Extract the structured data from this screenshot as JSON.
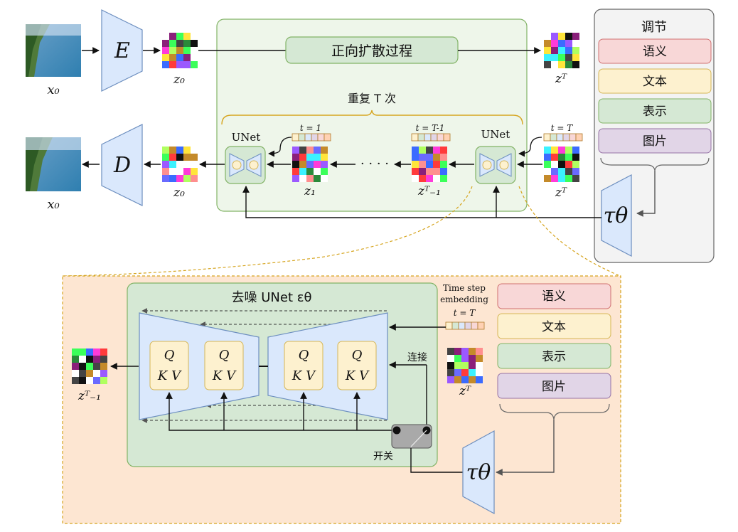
{
  "top": {
    "x0_in": "x₀",
    "x0_out": "x₀",
    "encoder": "E",
    "decoder": "D",
    "z0_in": "z₀",
    "z0_out": "z₀",
    "zT_top": "zᵀ",
    "forward_process": "正向扩散过程",
    "repeat": "重复 T 次",
    "unet_left": "UNet",
    "unet_right": "UNet",
    "z1": "z₁",
    "zT1": "zᵀ₋₁",
    "zT_mid": "zᵀ",
    "t1": "t = 1",
    "tT1": "t = T-1",
    "tT": "t = T",
    "dots": "· · · ·",
    "tau": "τθ"
  },
  "conditioning": {
    "title": "调节",
    "items": [
      {
        "label": "语义",
        "color": "#f8d7d7",
        "border": "#d07070"
      },
      {
        "label": "文本",
        "color": "#fdf1cf",
        "border": "#d6b656"
      },
      {
        "label": "表示",
        "color": "#d5e8d4",
        "border": "#82b366"
      },
      {
        "label": "图片",
        "color": "#e1d5e7",
        "border": "#9673a6"
      }
    ]
  },
  "detail": {
    "title": "去噪 UNet εθ",
    "time_step": "Time step",
    "embedding": "embedding",
    "tT": "t = T",
    "concat": "连接",
    "switch": "开关",
    "z_out": "zᵀ₋₁",
    "z_in": "zᵀ",
    "q": "Q",
    "kv": "K V",
    "tau": "τθ",
    "cond_items": [
      {
        "label": "语义",
        "color": "#f8d7d7",
        "border": "#d07070"
      },
      {
        "label": "文本",
        "color": "#fdf1cf",
        "border": "#d6b656"
      },
      {
        "label": "表示",
        "color": "#d5e8d4",
        "border": "#82b366"
      },
      {
        "label": "图片",
        "color": "#e1d5e7",
        "border": "#9673a6"
      }
    ]
  }
}
